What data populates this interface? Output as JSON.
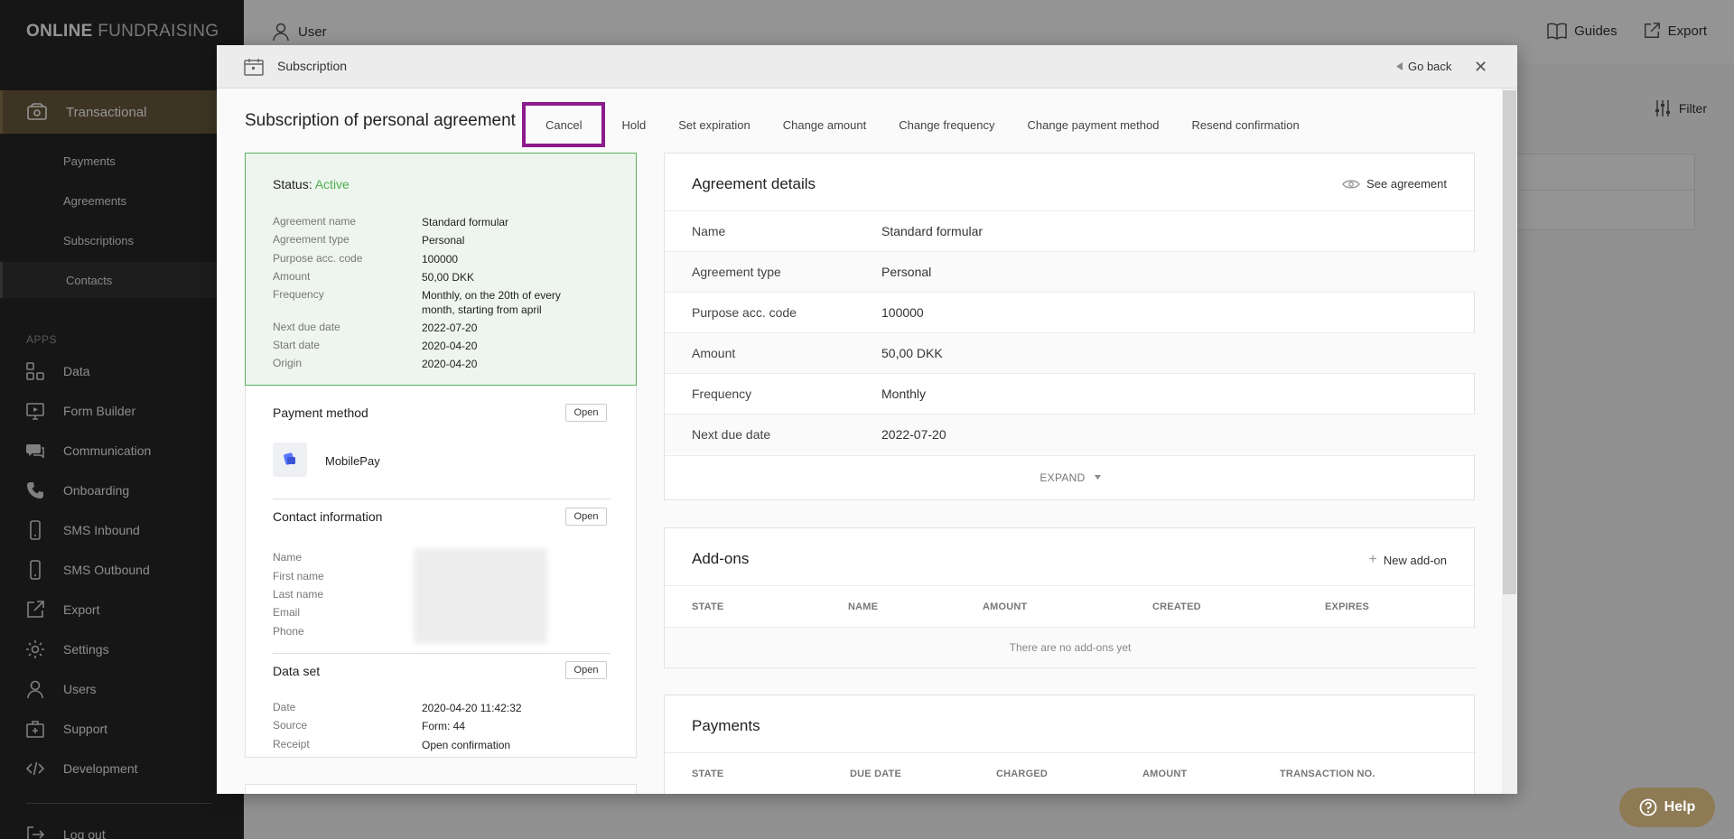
{
  "sidebar": {
    "logo_bold": "ONLINE",
    "logo_light": "FUNDRAISING",
    "main_item": "Transactional",
    "sub_items": [
      "Payments",
      "Agreements",
      "Subscriptions",
      "Contacts"
    ],
    "apps_title": "APPS",
    "apps": [
      {
        "label": "Data",
        "icon": "data-icon"
      },
      {
        "label": "Form Builder",
        "icon": "form-builder-icon"
      },
      {
        "label": "Communication",
        "icon": "communication-icon"
      },
      {
        "label": "Onboarding",
        "icon": "phone-icon"
      },
      {
        "label": "SMS Inbound",
        "icon": "mobile-icon"
      },
      {
        "label": "SMS Outbound",
        "icon": "mobile-icon"
      },
      {
        "label": "Export",
        "icon": "export-icon"
      },
      {
        "label": "Settings",
        "icon": "gear-icon"
      },
      {
        "label": "Users",
        "icon": "user-icon"
      },
      {
        "label": "Support",
        "icon": "support-icon"
      },
      {
        "label": "Development",
        "icon": "code-icon"
      }
    ],
    "logout": "Log out"
  },
  "topbar": {
    "user": "User",
    "guides": "Guides",
    "export": "Export",
    "filter": "Filter"
  },
  "help": "Help",
  "modal": {
    "title": "Subscription",
    "go_back": "Go back",
    "heading": "Subscription of personal agreement",
    "actions": [
      "Cancel",
      "Hold",
      "Set expiration",
      "Change amount",
      "Change frequency",
      "Change payment method",
      "Resend confirmation"
    ],
    "status_label": "Status:",
    "status_value": "Active",
    "summary": [
      {
        "k": "Agreement name",
        "v": "Standard formular"
      },
      {
        "k": "Agreement type",
        "v": "Personal"
      },
      {
        "k": "Purpose acc. code",
        "v": "100000"
      },
      {
        "k": "Amount",
        "v": "50,00 DKK"
      },
      {
        "k": "Frequency",
        "v": "Monthly, on the 20th of every month, starting from april"
      },
      {
        "k": "Next due date",
        "v": "2022-07-20"
      },
      {
        "k": "Start date",
        "v": "2020-04-20"
      },
      {
        "k": "Origin",
        "v": "2020-04-20"
      }
    ],
    "payment_method": {
      "title": "Payment method",
      "open": "Open",
      "name": "MobilePay"
    },
    "contact": {
      "title": "Contact information",
      "open": "Open",
      "fields": [
        "Name",
        "First name",
        "Last name",
        "Email",
        "Phone"
      ]
    },
    "data_set": {
      "title": "Data set",
      "open": "Open",
      "date_label": "Date",
      "date": "2020-04-20 11:42:32",
      "source_label": "Source",
      "source": "Form: 44",
      "receipt_label": "Receipt",
      "receipt": "Open confirmation"
    },
    "agreement_details": {
      "title": "Agreement details",
      "see": "See agreement",
      "rows": [
        {
          "k": "Name",
          "v": "Standard formular"
        },
        {
          "k": "Agreement type",
          "v": "Personal"
        },
        {
          "k": "Purpose acc. code",
          "v": "100000"
        },
        {
          "k": "Amount",
          "v": "50,00 DKK"
        },
        {
          "k": "Frequency",
          "v": "Monthly"
        },
        {
          "k": "Next due date",
          "v": "2022-07-20"
        }
      ],
      "expand": "EXPAND"
    },
    "addons": {
      "title": "Add-ons",
      "new": "New add-on",
      "columns": [
        "STATE",
        "NAME",
        "AMOUNT",
        "CREATED",
        "EXPIRES"
      ],
      "empty": "There are no add-ons yet"
    },
    "payments": {
      "title": "Payments",
      "columns": [
        "STATE",
        "DUE DATE",
        "CHARGED",
        "AMOUNT",
        "TRANSACTION NO."
      ]
    }
  }
}
